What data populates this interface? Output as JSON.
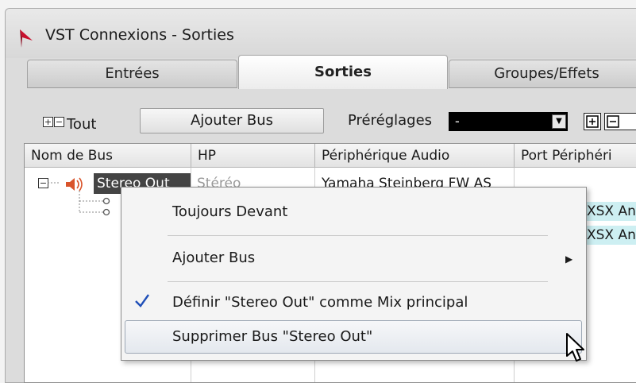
{
  "window": {
    "title": "VST Connexions - Sorties"
  },
  "tabs": [
    {
      "label": "Entrées",
      "active": false
    },
    {
      "label": "Sorties",
      "active": true
    },
    {
      "label": "Groupes/Effets",
      "active": false
    }
  ],
  "toolbar": {
    "all_label": "Tout",
    "add_bus_label": "Ajouter Bus",
    "presets_label": "Préréglages",
    "presets_value": "-"
  },
  "table": {
    "columns": [
      "Nom de Bus",
      "HP",
      "Périphérique Audio",
      "Port Périphéri"
    ],
    "bus": {
      "name": "Stereo Out",
      "speakers": "Stéréo",
      "device": "Yamaha Steinberg FW AS"
    },
    "channel_ports": [
      "XSX An",
      "XSX An"
    ]
  },
  "context_menu": {
    "items": [
      {
        "label": "Toujours Devant"
      },
      {
        "label": "Ajouter Bus",
        "has_submenu": true
      },
      {
        "label": "Définir \"Stereo Out\" comme Mix principal",
        "checked": true
      },
      {
        "label": "Supprimer Bus \"Stereo Out\"",
        "hovered": true
      }
    ]
  },
  "colors": {
    "selection_bg": "#444444",
    "port_cell_bg": "#cdeff2",
    "checkmark": "#1f4fb8",
    "logo_red": "#c8102e"
  }
}
